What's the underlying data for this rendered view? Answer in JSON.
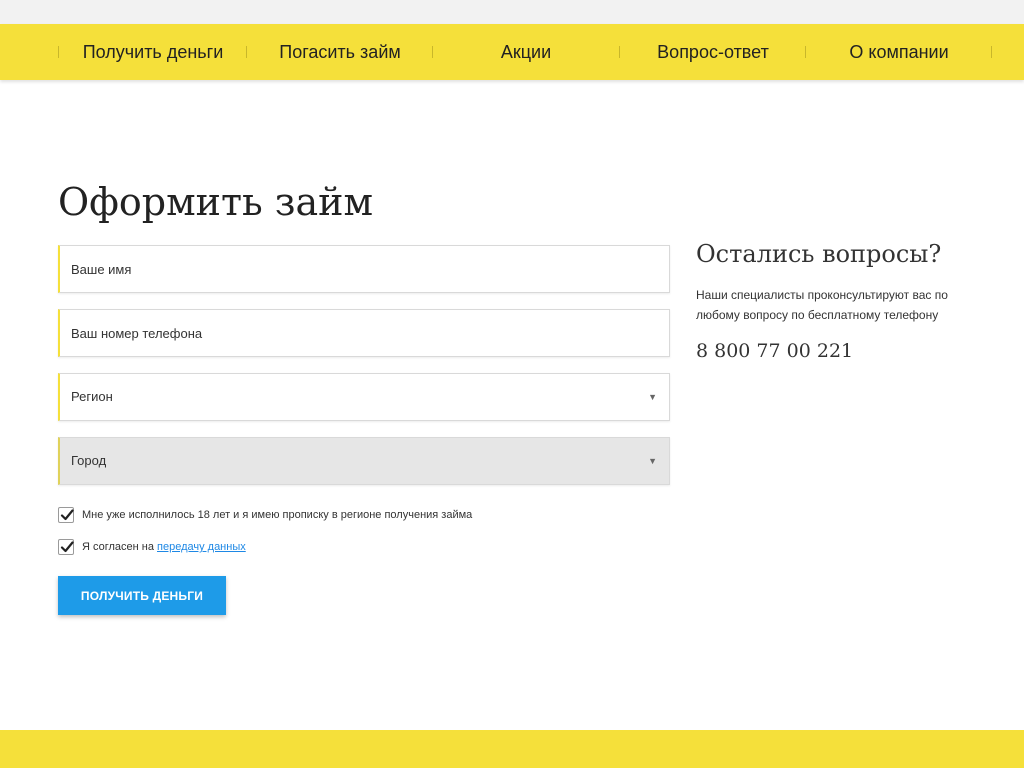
{
  "nav": {
    "items": [
      {
        "label": "Получить деньги"
      },
      {
        "label": "Погасить займ"
      },
      {
        "label": "Акции"
      },
      {
        "label": "Вопрос-ответ"
      },
      {
        "label": "О компании"
      }
    ]
  },
  "form": {
    "title": "Оформить займ",
    "name_placeholder": "Ваше имя",
    "phone_placeholder": "Ваш номер телефона",
    "region_label": "Регион",
    "city_label": "Город",
    "checkbox_age_label": "Мне уже исполнилось 18 лет и я имею прописку в регионе получения займа",
    "checkbox_age_checked": true,
    "checkbox_consent_prefix": "Я согласен на",
    "checkbox_consent_link": "передачу данных",
    "checkbox_consent_checked": true,
    "submit_label": "ПОЛУЧИТЬ ДЕНЬГИ"
  },
  "sidebar": {
    "title": "Остались вопросы?",
    "text": "Наши специалисты проконсультируют вас по любому вопросу по бесплатному телефону",
    "phone": "8 800 77 00 221"
  },
  "colors": {
    "accent_yellow": "#f5e03a",
    "button_blue": "#1e9be8",
    "link_blue": "#1e88e5",
    "disabled_gray": "#e6e6e6"
  }
}
